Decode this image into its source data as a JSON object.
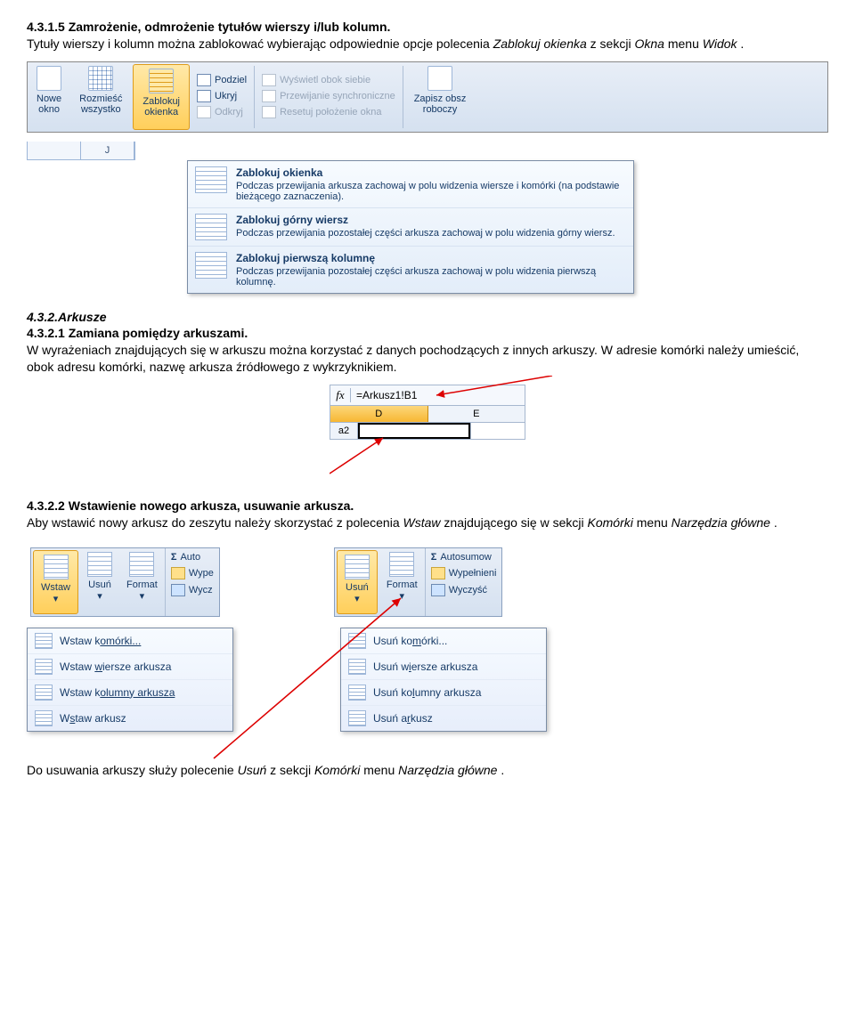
{
  "section1": {
    "heading": "4.3.1.5 Zamrożenie, odmrożenie tytułów wierszy i/lub kolumn.",
    "para_pre": "Tytuły wierszy i kolumn można zablokować wybierając odpowiednie opcje polecenia ",
    "para_em1": "Zablokuj okienka",
    "para_mid": " z sekcji ",
    "para_em2": "Okna",
    "para_mid2": " menu ",
    "para_em3": "Widok",
    "para_end": "."
  },
  "ribbon1": {
    "btn1": {
      "line1": "Nowe",
      "line2": "okno"
    },
    "btn2": {
      "line1": "Rozmieść",
      "line2": "wszystko"
    },
    "btn3": {
      "line1": "Zablokuj",
      "line2": "okienka"
    },
    "col1": {
      "a": "Podziel",
      "b": "Ukryj",
      "c": "Odkryj"
    },
    "col2": {
      "a": "Wyświetl obok siebie",
      "b": "Przewijanie synchroniczne",
      "c": "Resetuj położenie okna"
    },
    "btn4": {
      "line1": "Zapisz obsz",
      "line2": "roboczy"
    },
    "colhdr": "J"
  },
  "dropdown": {
    "item1": {
      "title": "Zablokuj okienka",
      "desc": "Podczas przewijania arkusza zachowaj w polu widzenia wiersze i komórki (na podstawie bieżącego zaznaczenia)."
    },
    "item2": {
      "title": "Zablokuj górny wiersz",
      "desc": "Podczas przewijania pozostałej części arkusza zachowaj w polu widzenia górny wiersz."
    },
    "item3": {
      "title": "Zablokuj pierwszą kolumnę",
      "desc": "Podczas przewijania pozostałej części arkusza zachowaj w polu widzenia pierwszą kolumnę."
    }
  },
  "section2": {
    "heading1": "4.3.2.Arkusze",
    "heading2": "4.3.2.1 Zamiana pomiędzy arkuszami.",
    "para": "W wyrażeniach znajdujących się w arkuszu można korzystać z danych pochodzących z innych arkuszy. W adresie komórki należy umieścić, obok adresu komórki, nazwę arkusza źródłowego z wykrzyknikiem."
  },
  "formula": {
    "fx": "fx",
    "text": "=Arkusz1!B1",
    "colD": "D",
    "colE": "E",
    "rowlabel": "a2"
  },
  "section3": {
    "heading": "4.3.2.2 Wstawienie nowego arkusza, usuwanie arkusza.",
    "para_pre": "Aby wstawić nowy arkusz do zeszytu należy skorzystać z polecenia ",
    "para_em1": "Wstaw",
    "para_mid1": " znajdującego się w sekcji ",
    "para_em2": "Komórki",
    "para_mid2": " menu ",
    "para_em3": "Narzędzia główne",
    "para_end": "."
  },
  "chunkL": {
    "b1": "Wstaw",
    "b2": "Usuń",
    "b3": "Format",
    "s1": "Auto",
    "s2": "Wype",
    "s3": "Wycz"
  },
  "chunkR": {
    "b1": "Usuń",
    "b2": "Format",
    "s1": "Autosumow",
    "s2": "Wypełnieni",
    "s3": "Wyczyść"
  },
  "menuL": {
    "m1a": "Wstaw k",
    "m1b": "omórki...",
    "m2a": "Wstaw ",
    "m2b": "w",
    "m2c": "iersze arkusza",
    "m3a": "Wstaw k",
    "m3b": "olumny arkusza",
    "m4a": "W",
    "m4b": "s",
    "m4c": "taw arkusz"
  },
  "menuR": {
    "m1a": "Usuń ko",
    "m1b": "m",
    "m1c": "órki...",
    "m2a": "Usuń w",
    "m2b": "i",
    "m2c": "ersze arkusza",
    "m3a": "Usuń ko",
    "m3b": "l",
    "m3c": "umny arkusza",
    "m4a": "Usuń a",
    "m4b": "r",
    "m4c": "kusz"
  },
  "footer": {
    "pre": "Do usuwania arkuszy służy polecenie ",
    "em1": "Usuń",
    "mid1": " z sekcji ",
    "em2": "Komórki",
    "mid2": " menu ",
    "em3": "Narzędzia główne",
    "end": "."
  }
}
